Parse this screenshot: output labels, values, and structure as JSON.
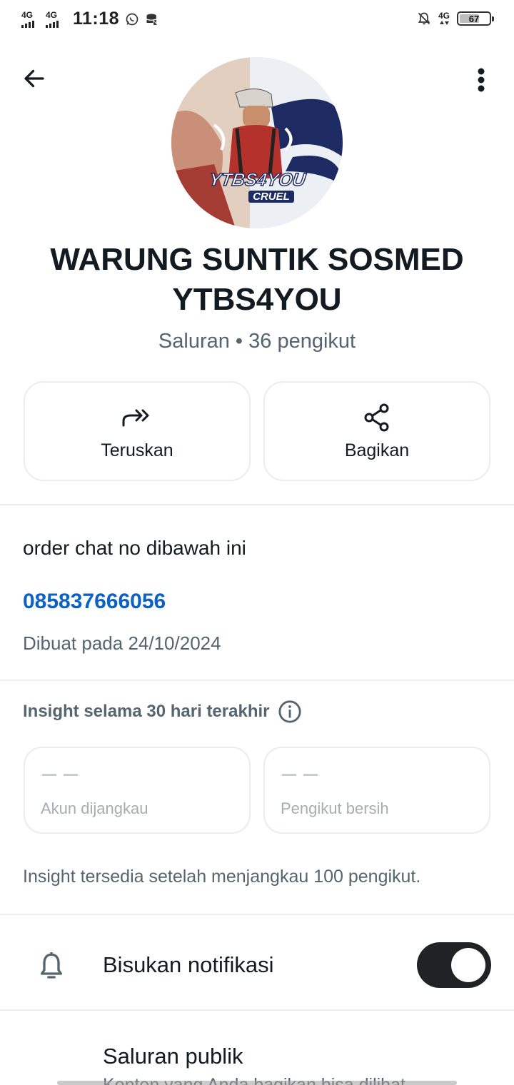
{
  "status_bar": {
    "network_1": "4G",
    "network_2": "4G",
    "time": "11:18",
    "right_network": "4G",
    "battery": "67",
    "battery_fraction": 0.67
  },
  "channel": {
    "avatar_text_main": "YTBS4YOU",
    "avatar_text_sub": "CRUEL",
    "name": "WARUNG SUNTIK SOSMED YTBS4YOU",
    "subtitle": "Saluran • 36 pengikut"
  },
  "actions": {
    "forward_label": "Teruskan",
    "share_label": "Bagikan"
  },
  "about": {
    "description": "order chat no dibawah ini",
    "phone": "085837666056",
    "created": "Dibuat pada 24/10/2024"
  },
  "insights": {
    "heading": "Insight selama 30 hari terakhir",
    "reach_value": "— —",
    "reach_label": "Akun dijangkau",
    "net_value": "— —",
    "net_label": "Pengikut bersih",
    "note": "Insight tersedia setelah menjangkau 100 pengikut."
  },
  "settings": {
    "mute_label": "Bisukan notifikasi",
    "mute_on": true,
    "public_title": "Saluran publik",
    "public_sub": "Konten yang Anda bagikan bisa dilihat"
  },
  "colors": {
    "link": "#0b62c4",
    "toggle_on": "#1f2326",
    "secondary_text": "#54656f"
  },
  "icons": [
    "back-arrow-icon",
    "more-vert-icon",
    "forward-icon",
    "share-icon",
    "info-icon",
    "bell-icon"
  ]
}
